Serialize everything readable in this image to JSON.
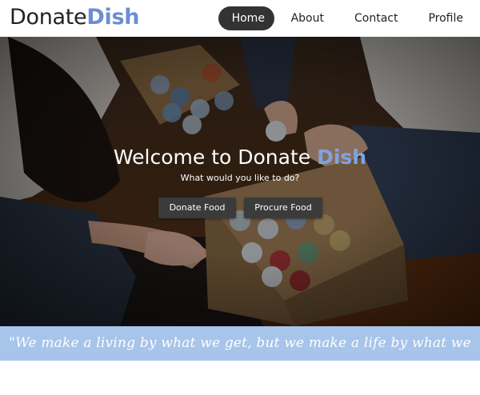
{
  "brand": {
    "name_part1": "Donate",
    "name_part2": "Dish"
  },
  "nav": {
    "items": [
      {
        "label": "Home"
      },
      {
        "label": "About"
      },
      {
        "label": "Contact"
      },
      {
        "label": "Profile"
      }
    ]
  },
  "hero": {
    "title_part1": "Welcome to Donate ",
    "title_part2": "Dish",
    "subtitle": "What would you like to do?",
    "buttons": {
      "donate_label": "Donate Food",
      "procure_label": "Procure Food"
    }
  },
  "footer": {
    "quote": "\"We make a living by what we get, but we make a life by what we give.\""
  },
  "colors": {
    "accent": "#6a8fd0",
    "quote_bar": "#a7c4ea",
    "nav_active": "#333333",
    "button": "#3b3b3b"
  }
}
